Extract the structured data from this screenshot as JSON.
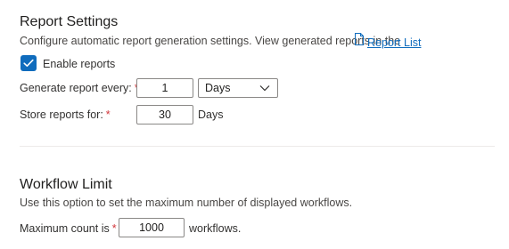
{
  "report_settings": {
    "title": "Report Settings",
    "description": "Configure automatic report generation settings. View generated reports in the",
    "report_list_link": "Report List",
    "enable_reports": {
      "label": "Enable reports",
      "checked": true
    },
    "generate_every": {
      "label": "Generate report every:",
      "required_mark": "*",
      "value": "1",
      "unit_selected": "Days"
    },
    "store_for": {
      "label": "Store reports for:",
      "required_mark": "*",
      "value": "30",
      "unit": "Days"
    }
  },
  "workflow_limit": {
    "title": "Workflow Limit",
    "description": "Use this option to set the maximum number of displayed workflows.",
    "max_count": {
      "label": "Maximum count is",
      "required_mark": "*",
      "value": "1000",
      "unit": "workflows."
    }
  },
  "colors": {
    "accent": "#0f6cbd",
    "required": "#d13438",
    "divider": "#edebe9"
  },
  "icons": {
    "report_list": "document-icon",
    "checkbox": "checkmark-icon",
    "dropdown": "chevron-down-icon"
  }
}
